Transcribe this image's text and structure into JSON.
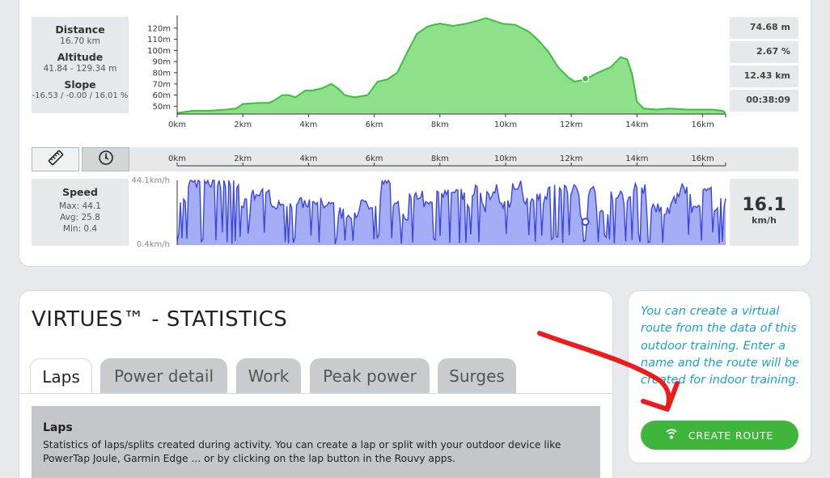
{
  "elevation_stats": {
    "distance_label": "Distance",
    "distance_value": "16.70 km",
    "altitude_label": "Altitude",
    "altitude_value": "41.84 - 129.34 m",
    "slope_label": "Slope",
    "slope_value": "-16.53 / -0.00 / 16.01 %"
  },
  "cursor_readout": {
    "altitude": "74.68 m",
    "slope": "2.67 %",
    "distance": "12.43 km",
    "time": "00:38:09"
  },
  "speed_stats": {
    "label": "Speed",
    "max": "Max: 44.1",
    "avg": "Avg: 25.8",
    "min": "Min: 0.4",
    "current_value": "16.1",
    "current_unit": "km/h"
  },
  "chart_data": [
    {
      "type": "area",
      "x_unit": "km",
      "x": [
        0,
        0.5,
        1,
        1.5,
        1.8,
        2,
        2.5,
        2.8,
        3,
        3.2,
        3.4,
        3.6,
        3.9,
        4.1,
        4.4,
        4.7,
        4.9,
        5.1,
        5.4,
        5.8,
        6.1,
        6.4,
        6.7,
        7,
        7.3,
        7.6,
        7.8,
        8,
        8.4,
        8.8,
        9.2,
        9.4,
        9.6,
        9.9,
        10.3,
        10.7,
        11,
        11.3,
        11.6,
        11.9,
        12.1,
        12.43,
        12.8,
        13.2,
        13.5,
        13.7,
        13.85,
        14,
        14.2,
        14.6,
        15,
        15.5,
        16,
        16.3,
        16.6,
        16.7
      ],
      "values": [
        44,
        46,
        46,
        47,
        48,
        52,
        53,
        53,
        56,
        60,
        60,
        58,
        64,
        64,
        66,
        70,
        66,
        60,
        58,
        60,
        72,
        74,
        80,
        98,
        115,
        121,
        123,
        124,
        122,
        124,
        127,
        129,
        127,
        124,
        123,
        117,
        109,
        99,
        85,
        76,
        72,
        74,
        80,
        85,
        94,
        92,
        79,
        54,
        48,
        47,
        48,
        47,
        47,
        47,
        46,
        44
      ],
      "y_ticks": [
        "50m",
        "60m",
        "70m",
        "80m",
        "90m",
        "100m",
        "110m",
        "120m"
      ],
      "x_ticks": [
        "0km",
        "2km",
        "4km",
        "6km",
        "8km",
        "10km",
        "12km",
        "14km",
        "16km"
      ],
      "ylim": [
        43,
        130
      ],
      "xlim": [
        0,
        16.7
      ],
      "fill_color": "#8fe08a",
      "line_color": "#3cbf3a",
      "marker_x": 12.43,
      "marker_y": 74.68
    },
    {
      "type": "line",
      "x_unit": "km",
      "y_top_label": "44.1km/h",
      "y_bottom_label": "0.4km/h",
      "ylim": [
        0.4,
        44.1
      ],
      "xlim": [
        0,
        16.7
      ],
      "x_ticks": [
        "0km",
        "2km",
        "4km",
        "6km",
        "8km",
        "10km",
        "12km",
        "14km",
        "16km"
      ],
      "fill_color": "#a5aef5",
      "line_color": "#3a46e0",
      "marker_x": 12.43,
      "marker_y": 16.1
    }
  ],
  "mode_buttons": {
    "distance_icon": "ruler-icon",
    "time_icon": "stopwatch-icon"
  },
  "stats_section": {
    "title": "VIRTUES™ - STATISTICS",
    "tabs": [
      "Laps",
      "Power detail",
      "Work",
      "Peak power",
      "Surges"
    ],
    "active_tab": "Laps",
    "laps_heading": "Laps",
    "laps_text_line1": "Statistics of laps/splits created during activity. You can create a lap or split with your outdoor device like",
    "laps_text_line2": "PowerTap Joule, Garmin Edge ... or by clicking on the lap button in the Rouvy apps."
  },
  "route_section": {
    "text": "You can create a virtual route from the data of this outdoor training. Enter a name and the route will be created for indoor training.",
    "button_label": "CREATE ROUTE",
    "button_icon": "route-pin-icon",
    "button_color": "#3fb53b",
    "text_color": "#1ba1c9"
  }
}
